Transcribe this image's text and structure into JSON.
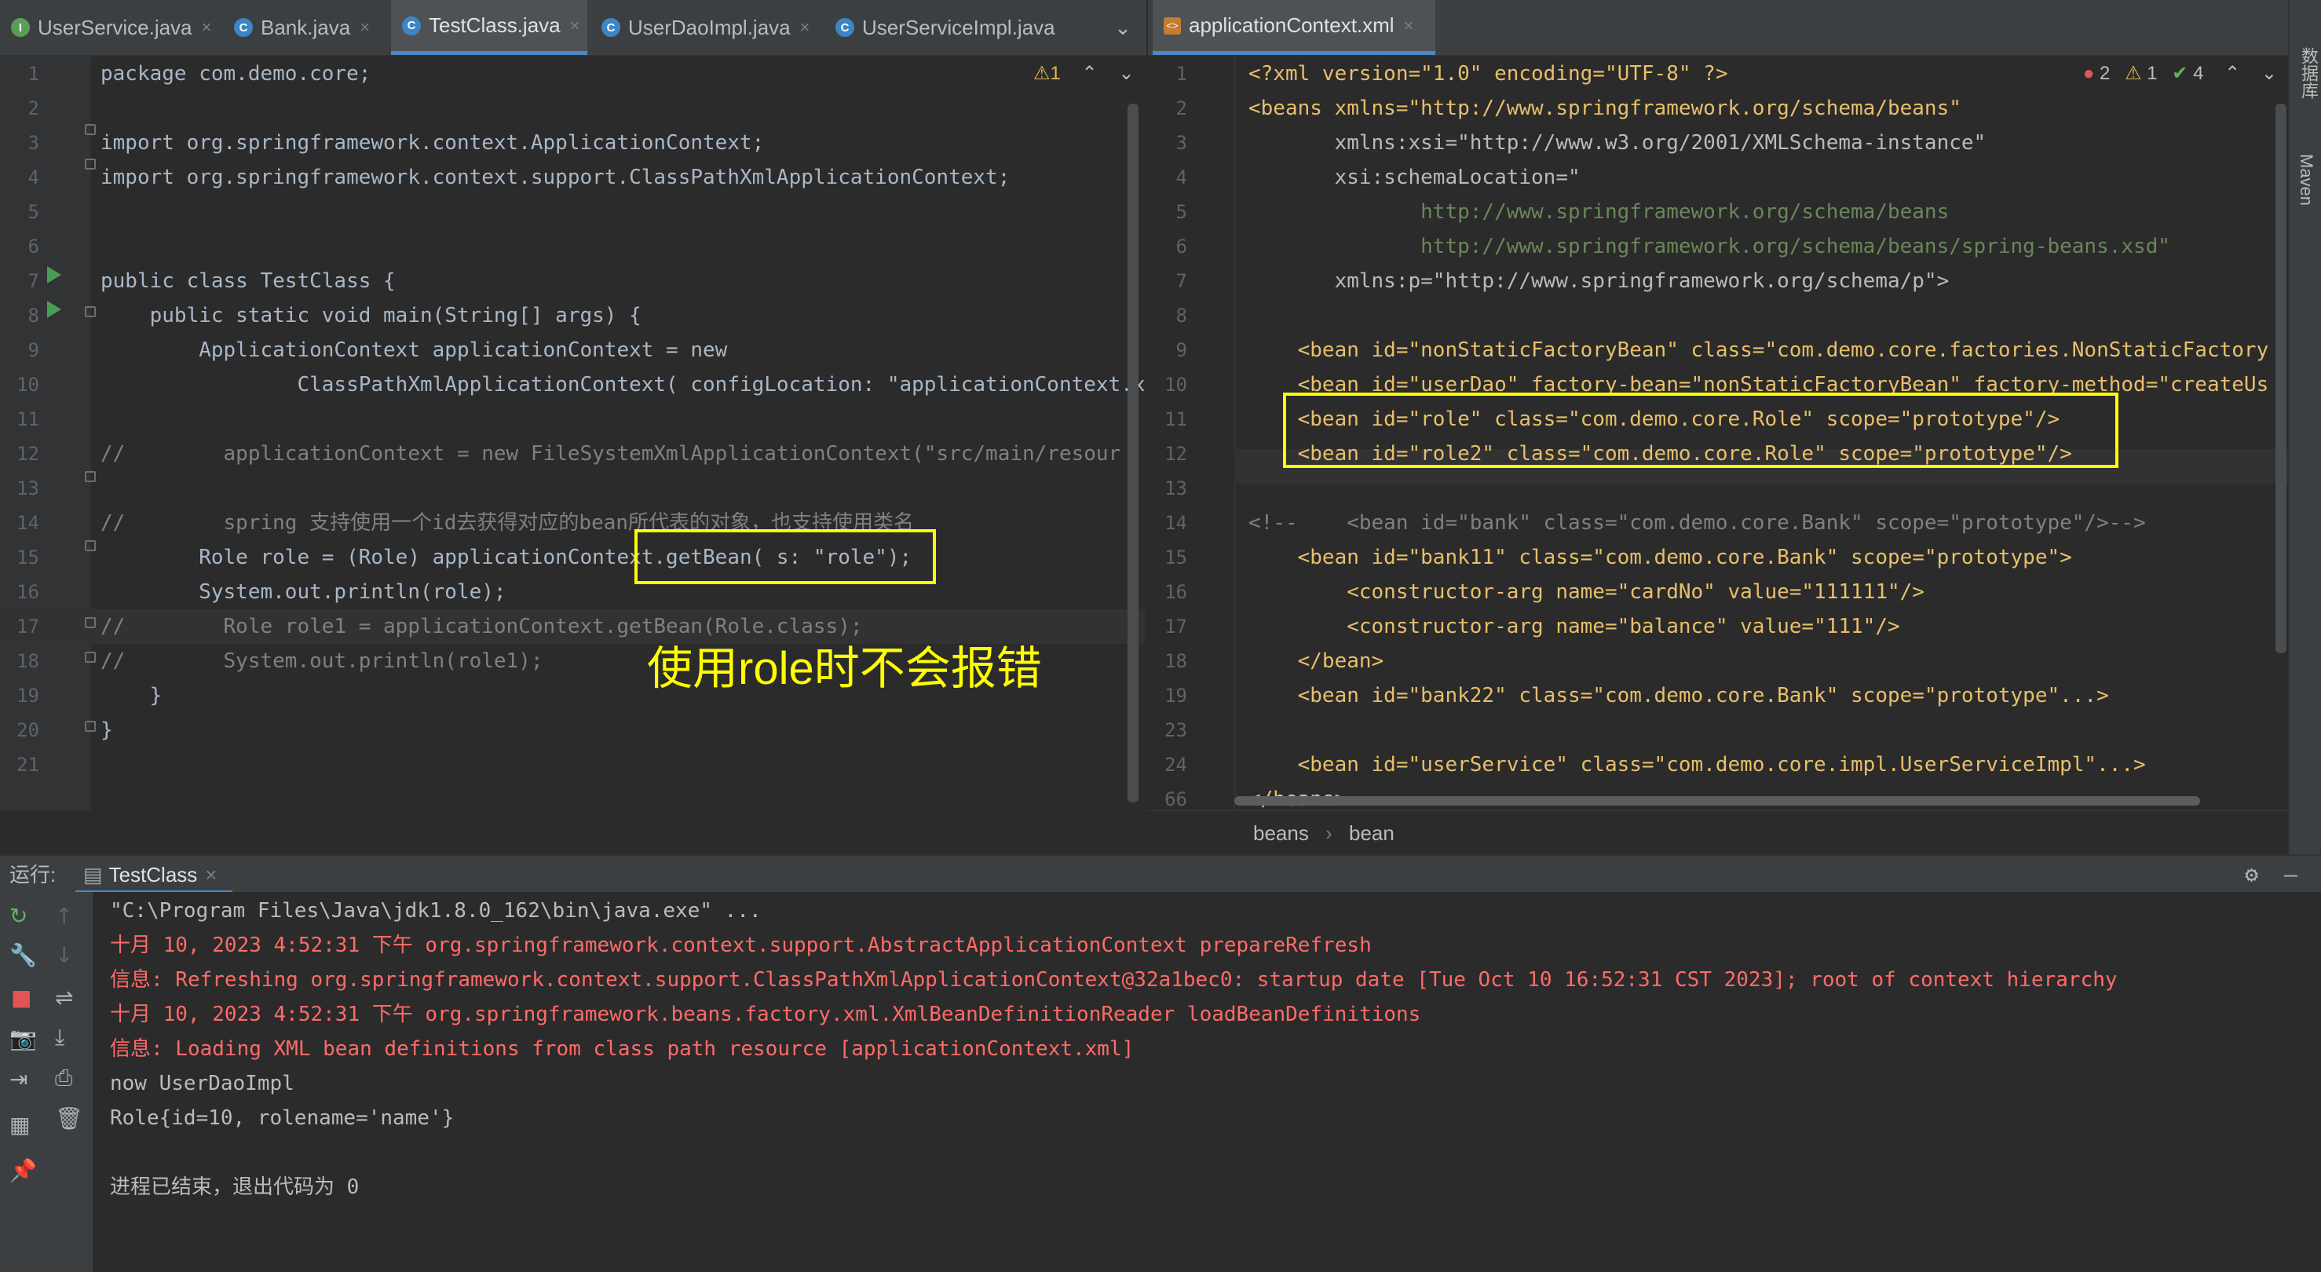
{
  "left_tabs": [
    {
      "label": "UserService.java",
      "icon": "interface-icon"
    },
    {
      "label": "Bank.java",
      "icon": "class-icon"
    },
    {
      "label": "TestClass.java",
      "icon": "class-icon",
      "active": true
    },
    {
      "label": "UserDaoImpl.java",
      "icon": "class-icon"
    },
    {
      "label": "UserServiceImpl.java",
      "icon": "class-icon"
    }
  ],
  "right_tabs": [
    {
      "label": "applicationContext.xml",
      "icon": "xml-file-icon",
      "active": true
    }
  ],
  "java_editor": {
    "inspection": "⚠1",
    "hint_config": "configLocation:",
    "hint_s": "s:",
    "lines": [
      {
        "n": "1",
        "t": "package com.demo.core;"
      },
      {
        "n": "2",
        "t": ""
      },
      {
        "n": "3",
        "t": "import org.springframework.context.ApplicationContext;"
      },
      {
        "n": "4",
        "t": "import org.springframework.context.support.ClassPathXmlApplicationContext;"
      },
      {
        "n": "5",
        "t": ""
      },
      {
        "n": "6",
        "t": ""
      },
      {
        "n": "7",
        "t": "public class TestClass {"
      },
      {
        "n": "8",
        "t": "    public static void main(String[] args) {"
      },
      {
        "n": "9",
        "t": "        ApplicationContext applicationContext = new"
      },
      {
        "n": "10",
        "t": "                ClassPathXmlApplicationContext( configLocation: \"applicationContext.xml\""
      },
      {
        "n": "11",
        "t": ""
      },
      {
        "n": "12",
        "t": "//        applicationContext = new FileSystemXmlApplicationContext(\"src/main/resour"
      },
      {
        "n": "13",
        "t": ""
      },
      {
        "n": "14",
        "t": "//        spring 支持使用一个id去获得对应的bean所代表的对象，也支持使用类名"
      },
      {
        "n": "15",
        "t": "        Role role = (Role) applicationContext.getBean( s: \"role\");"
      },
      {
        "n": "16",
        "t": "        System.out.println(role);"
      },
      {
        "n": "17",
        "t": "//        Role role1 = applicationContext.getBean(Role.class);"
      },
      {
        "n": "18",
        "t": "//        System.out.println(role1);"
      },
      {
        "n": "19",
        "t": "    }"
      },
      {
        "n": "20",
        "t": "}"
      },
      {
        "n": "21",
        "t": ""
      }
    ]
  },
  "annotation": "使用role时不会报错",
  "xml_editor": {
    "inspection_errors": "2",
    "inspection_warnings": "1",
    "inspection_ok": "4",
    "lines": [
      {
        "n": "1",
        "t": "<?xml version=\"1.0\" encoding=\"UTF-8\" ?>"
      },
      {
        "n": "2",
        "t": "<beans xmlns=\"http://www.springframework.org/schema/beans\""
      },
      {
        "n": "3",
        "t": "       xmlns:xsi=\"http://www.w3.org/2001/XMLSchema-instance\""
      },
      {
        "n": "4",
        "t": "       xsi:schemaLocation=\""
      },
      {
        "n": "5",
        "t": "              http://www.springframework.org/schema/beans"
      },
      {
        "n": "6",
        "t": "              http://www.springframework.org/schema/beans/spring-beans.xsd\""
      },
      {
        "n": "7",
        "t": "       xmlns:p=\"http://www.springframework.org/schema/p\">"
      },
      {
        "n": "8",
        "t": ""
      },
      {
        "n": "9",
        "t": "    <bean id=\"nonStaticFactoryBean\" class=\"com.demo.core.factories.NonStaticFactory"
      },
      {
        "n": "10",
        "t": "    <bean id=\"userDao\" factory-bean=\"nonStaticFactoryBean\" factory-method=\"createUs"
      },
      {
        "n": "11",
        "t": "    <bean id=\"role\" class=\"com.demo.core.Role\" scope=\"prototype\"/>"
      },
      {
        "n": "12",
        "t": "    <bean id=\"role2\" class=\"com.demo.core.Role\" scope=\"prototype\"/>"
      },
      {
        "n": "13",
        "t": ""
      },
      {
        "n": "14",
        "t": "<!--    <bean id=\"bank\" class=\"com.demo.core.Bank\" scope=\"prototype\"/>-->"
      },
      {
        "n": "15",
        "t": "    <bean id=\"bank11\" class=\"com.demo.core.Bank\" scope=\"prototype\">"
      },
      {
        "n": "16",
        "t": "        <constructor-arg name=\"cardNo\" value=\"111111\"/>"
      },
      {
        "n": "17",
        "t": "        <constructor-arg name=\"balance\" value=\"111\"/>"
      },
      {
        "n": "18",
        "t": "    </bean>"
      },
      {
        "n": "19",
        "t": "    <bean id=\"bank22\" class=\"com.demo.core.Bank\" scope=\"prototype\"...>"
      },
      {
        "n": "23",
        "t": ""
      },
      {
        "n": "24",
        "t": "    <bean id=\"userService\" class=\"com.demo.core.impl.UserServiceImpl\"...>"
      },
      {
        "n": "66",
        "t": "</beans>"
      }
    ],
    "breadcrumb": [
      "beans",
      "bean"
    ]
  },
  "right_sidebar": [
    "数据库",
    "Maven"
  ],
  "run_panel": {
    "label": "运行:",
    "tab": "TestClass",
    "lines": [
      {
        "t": "\"C:\\Program Files\\Java\\jdk1.8.0_162\\bin\\java.exe\" ...",
        "c": "gray"
      },
      {
        "t": "十月 10, 2023 4:52:31 下午 org.springframework.context.support.AbstractApplicationContext prepareRefresh",
        "c": "red"
      },
      {
        "t": "信息: Refreshing org.springframework.context.support.ClassPathXmlApplicationContext@32a1bec0: startup date [Tue Oct 10 16:52:31 CST 2023]; root of context hierarchy",
        "c": "red"
      },
      {
        "t": "十月 10, 2023 4:52:31 下午 org.springframework.beans.factory.xml.XmlBeanDefinitionReader loadBeanDefinitions",
        "c": "red"
      },
      {
        "t": "信息: Loading XML bean definitions from class path resource [applicationContext.xml]",
        "c": "red"
      },
      {
        "t": "now UserDaoImpl",
        "c": "gray"
      },
      {
        "t": "Role{id=10, rolename='name'}",
        "c": "gray"
      },
      {
        "t": "",
        "c": "gray"
      },
      {
        "t": "进程已结束，退出代码为 0",
        "c": "gray"
      }
    ]
  }
}
